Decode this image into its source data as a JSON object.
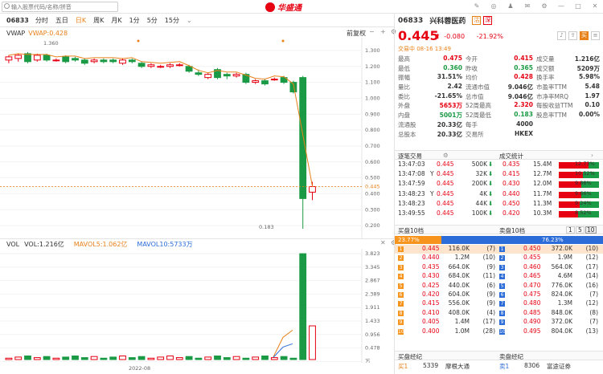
{
  "search": {
    "placeholder": "输入股票代码/名称/拼音"
  },
  "app": {
    "logo": "华盛通"
  },
  "window": {
    "icons": [
      "edit-icon",
      "headset-icon",
      "shirt-icon",
      "mail-icon",
      "settings-icon",
      "minimize-icon",
      "maximize-icon",
      "close-icon"
    ]
  },
  "timeframe": {
    "code": "06833",
    "items": [
      "分时",
      "五日",
      "日K",
      "周K",
      "月K",
      "1分",
      "5分",
      "15分"
    ],
    "active": 2
  },
  "vwap": {
    "label": "VWAP",
    "value": "VWAP:0.428",
    "adjust": "前复权"
  },
  "vol": {
    "label": "VOL",
    "vol": "VOL:1.216亿",
    "ma5": "MAVOL5:1.062亿",
    "ma10": "MAVOL10:5733万"
  },
  "chart_axis": {
    "price_ticks": [
      "1.300",
      "1.200",
      "1.100",
      "1.000",
      "0.900",
      "0.800",
      "0.700",
      "0.600",
      "0.500",
      "0.445",
      "0.400",
      "0.300",
      "0.200"
    ],
    "vol_ticks": [
      "3.823",
      "3.345",
      "2.867",
      "2.389",
      "1.911",
      "1.433",
      "0.956",
      "0.478",
      "万"
    ],
    "date": "2022-08",
    "high_label": "1.360",
    "low_label": "0.183"
  },
  "chart_data": {
    "type": "candlestick",
    "note_high": 1.36,
    "note_low": 0.183,
    "last": 0.445,
    "ylim": [
      0.15,
      1.35
    ]
  },
  "stock": {
    "code": "06833",
    "name": "兴科蓉医药",
    "tag1": "沽",
    "tag2": "深",
    "price": "0.445",
    "change": "-0.080",
    "change_pct": "-21.92%",
    "status": "交易中 08-16 13:49"
  },
  "quote": [
    [
      "最高",
      "0.475",
      "今开",
      "0.415",
      "成交量",
      "1.216亿"
    ],
    [
      "最低",
      "0.360",
      "昨收",
      "0.365",
      "成交额",
      "5209万"
    ],
    [
      "振幅",
      "31.51%",
      "均价",
      "0.428",
      "换手率",
      "5.98%"
    ],
    [
      "量比",
      "2.42",
      "流通市值",
      "9.046亿",
      "市盈率TTM",
      "5.48"
    ],
    [
      "委比",
      "-21.65%",
      "总市值",
      "9.046亿",
      "市净率MRQ",
      "1.97"
    ],
    [
      "外盘",
      "5653万",
      "52周最高",
      "2.320",
      "每股收益TTM",
      "0.10"
    ],
    [
      "内盘",
      "5001万",
      "52周最低",
      "0.183",
      "股息率TTM",
      "0.00%"
    ],
    [
      "流通股",
      "20.33亿",
      "每手",
      "4000",
      "",
      ""
    ],
    [
      "总股本",
      "20.33亿",
      "交易所",
      "HKEX",
      "",
      ""
    ]
  ],
  "ticks_title": "逐笔交易",
  "stats_title": "成交统计",
  "ticks": [
    [
      "13:47:03",
      "0.445",
      "500K"
    ],
    [
      "13:47:08",
      "0.445",
      "32K"
    ],
    [
      "13:47:59",
      "0.445",
      "200K"
    ],
    [
      "13:48:23",
      "0.445",
      "4K"
    ],
    [
      "13:48:23",
      "0.445",
      "44K"
    ],
    [
      "13:49:55",
      "0.445",
      "100K"
    ]
  ],
  "ticks_flag": [
    "",
    "Y",
    "",
    "Y",
    "",
    ""
  ],
  "tick_dir": [
    "down",
    "down",
    "down",
    "down",
    "down",
    "down"
  ],
  "stats": [
    [
      "0.435",
      "15.4M",
      "12.73%"
    ],
    [
      "0.415",
      "12.7M",
      "10.52%"
    ],
    [
      "0.430",
      "12.0M",
      "9.88%"
    ],
    [
      "0.440",
      "11.7M",
      "9.66%"
    ],
    [
      "0.450",
      "11.3M",
      "9.24%"
    ],
    [
      "0.420",
      "10.3M",
      "8.52%"
    ]
  ],
  "stats_fill": [
    0.74,
    0.6,
    0.56,
    0.55,
    0.52,
    0.48
  ],
  "ob": {
    "buy_title": "买盘10档",
    "sell_title": "卖盘10档",
    "pages": [
      "1",
      "5",
      "10"
    ],
    "buy_pct": "23.77%",
    "sell_pct": "76.23%",
    "buy": [
      [
        "1",
        "0.445",
        "116.0K",
        "(7)"
      ],
      [
        "2",
        "0.440",
        "1.2M",
        "(10)"
      ],
      [
        "3",
        "0.435",
        "664.0K",
        "(9)"
      ],
      [
        "4",
        "0.430",
        "684.0K",
        "(11)"
      ],
      [
        "5",
        "0.425",
        "440.0K",
        "(6)"
      ],
      [
        "6",
        "0.420",
        "604.0K",
        "(9)"
      ],
      [
        "7",
        "0.415",
        "556.0K",
        "(9)"
      ],
      [
        "8",
        "0.410",
        "408.0K",
        "(4)"
      ],
      [
        "9",
        "0.405",
        "1.4M",
        "(17)"
      ],
      [
        "10",
        "0.400",
        "1.0M",
        "(28)"
      ]
    ],
    "sell": [
      [
        "1",
        "0.450",
        "372.0K",
        "(10)"
      ],
      [
        "2",
        "0.455",
        "1.9M",
        "(12)"
      ],
      [
        "3",
        "0.460",
        "564.0K",
        "(17)"
      ],
      [
        "4",
        "0.465",
        "4.6M",
        "(14)"
      ],
      [
        "5",
        "0.470",
        "776.0K",
        "(16)"
      ],
      [
        "6",
        "0.475",
        "824.0K",
        "(7)"
      ],
      [
        "7",
        "0.480",
        "1.3M",
        "(12)"
      ],
      [
        "8",
        "0.485",
        "848.0K",
        "(8)"
      ],
      [
        "9",
        "0.490",
        "372.0K",
        "(7)"
      ],
      [
        "10",
        "0.495",
        "804.0K",
        "(13)"
      ]
    ]
  },
  "brokers": {
    "buy_title": "买盘经纪",
    "sell_title": "卖盘经纪",
    "buy": [
      "买1",
      "5339",
      "摩根大通"
    ],
    "sell": [
      "卖1",
      "8306",
      "富途证券"
    ]
  }
}
